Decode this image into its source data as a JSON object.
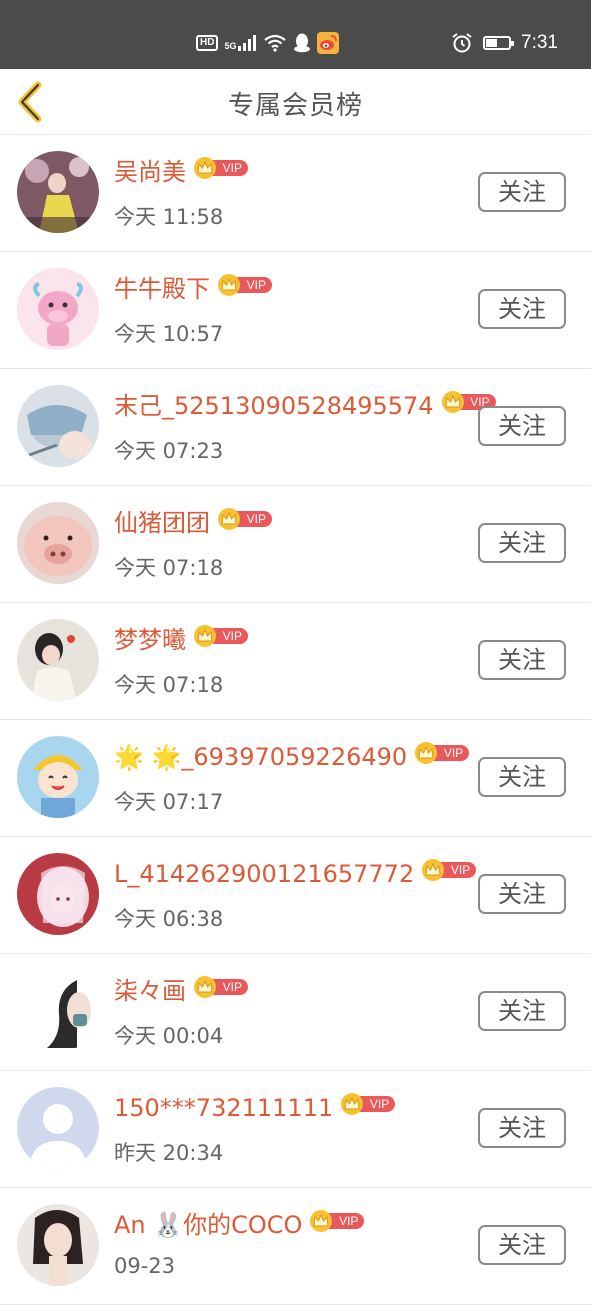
{
  "status_bar": {
    "hd_label": "HD",
    "network_label": "5G",
    "time": "7:31",
    "battery_level": 0.5,
    "icons": [
      "hd-icon",
      "signal-icon",
      "wifi-icon",
      "qq-penguin-icon",
      "weibo-icon",
      "alarm-icon",
      "battery-icon"
    ]
  },
  "header": {
    "title": "专属会员榜",
    "back_icon": "chevron-left-icon",
    "accent_color": "#f6c230"
  },
  "colors": {
    "name": "#dc5a37",
    "vip_pill": "#e9585a",
    "vip_crown": "#f6c230"
  },
  "members": [
    {
      "name": "吴尚美",
      "vip": "VIP",
      "time": "今天 11:58",
      "action": "关注",
      "avatar": "photo-avatar"
    },
    {
      "name": "牛牛殿下",
      "vip": "VIP",
      "time": "今天 10:57",
      "action": "关注",
      "avatar": "pink-cow-avatar"
    },
    {
      "name": "末己_52513090528495574",
      "vip": "VIP",
      "time": "今天 07:23",
      "action": "关注",
      "avatar": "anime-avatar"
    },
    {
      "name": "仙猪团团",
      "vip": "VIP",
      "time": "今天 07:18",
      "action": "关注",
      "avatar": "pig-avatar"
    },
    {
      "name": "梦梦曦",
      "vip": "VIP",
      "time": "今天 07:18",
      "action": "关注",
      "avatar": "girl-photo-avatar"
    },
    {
      "name": "🌟 🌟_69397059226490",
      "vip": "VIP",
      "time": "今天 07:17",
      "action": "关注",
      "avatar": "cartoon-kid-avatar"
    },
    {
      "name": "L_414262900121657772",
      "vip": "VIP",
      "time": "今天 06:38",
      "action": "关注",
      "avatar": "anime-girl-avatar"
    },
    {
      "name": "柒々画",
      "vip": "VIP",
      "time": "今天 00:04",
      "action": "关注",
      "avatar": "side-profile-avatar"
    },
    {
      "name": "150***732111111",
      "vip": "VIP",
      "time": "昨天 20:34",
      "action": "关注",
      "avatar": "default-person-avatar"
    },
    {
      "name": "An 🐰你的COCO",
      "vip": "VIP",
      "time": "09-23",
      "action": "关注",
      "avatar": "woman-photo-avatar"
    }
  ]
}
